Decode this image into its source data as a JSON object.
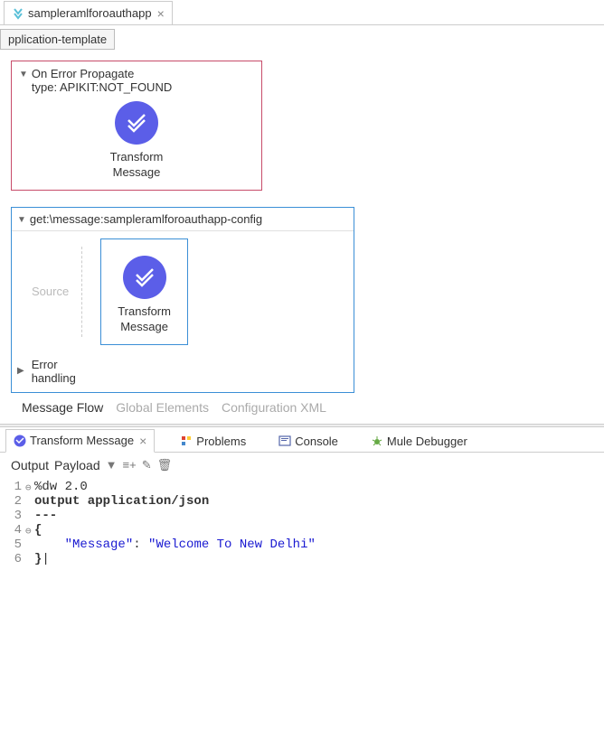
{
  "top_tab": {
    "label": "sampleramlforoauthapp"
  },
  "tooltip": "pplication-template",
  "error_block": {
    "title": "On Error Propagate",
    "subtitle": "type: APIKIT:NOT_FOUND",
    "component_label_1": "Transform",
    "component_label_2": "Message"
  },
  "flow": {
    "title": "get:\\message:sampleramlforoauthapp-config",
    "source_label": "Source",
    "component_label_1": "Transform",
    "component_label_2": "Message",
    "error_label_1": "Error",
    "error_label_2": "handling"
  },
  "view_tabs": {
    "flow": "Message Flow",
    "global": "Global Elements",
    "xml": "Configuration XML"
  },
  "bottom_tabs": {
    "transform": "Transform Message",
    "problems": "Problems",
    "console": "Console",
    "debugger": "Mule Debugger"
  },
  "output_bar": {
    "output": "Output",
    "payload": "Payload"
  },
  "code": {
    "l1": "%dw 2.0",
    "l2": "output application/json",
    "l3": "---",
    "l4": "{",
    "l5_key": "\"Message\"",
    "l5_sep": ": ",
    "l5_val": "\"Welcome To New Delhi\"",
    "l6": "}"
  }
}
